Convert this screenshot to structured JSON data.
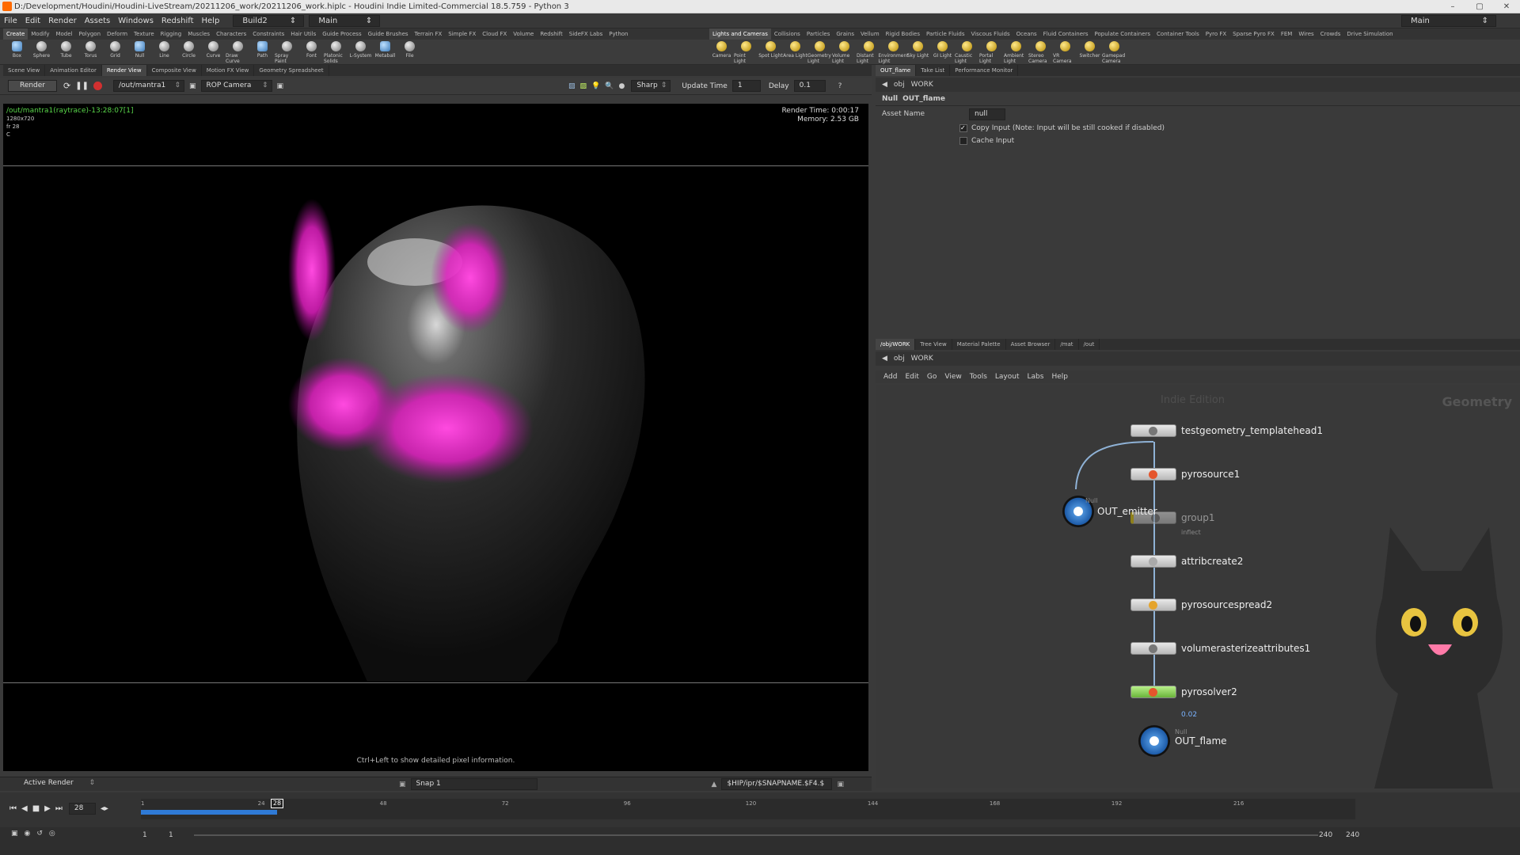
{
  "titlebar": {
    "title": "D:/Development/Houdini/Houdini-LiveStream/20211206_work/20211206_work.hiplc - Houdini Indie Limited-Commercial 18.5.759 - Python 3"
  },
  "menu": [
    "File",
    "Edit",
    "Render",
    "Assets",
    "Windows",
    "Redshift",
    "Help"
  ],
  "desktop": {
    "build": "Build2",
    "main": "Main",
    "right_main": "Main"
  },
  "shelf_tabs_left": [
    "Create",
    "Modify",
    "Model",
    "Polygon",
    "Deform",
    "Texture",
    "Rigging",
    "Muscles",
    "Characters",
    "Constraints",
    "Hair Utils",
    "Guide Process",
    "Guide Brushes",
    "Terrain FX",
    "Simple FX",
    "Cloud FX",
    "Volume",
    "Redshift",
    "SideFX Labs",
    "Python"
  ],
  "shelf_tabs_right": [
    "Lights and Cameras",
    "Collisions",
    "Particles",
    "Grains",
    "Vellum",
    "Rigid Bodies",
    "Particle Fluids",
    "Viscous Fluids",
    "Oceans",
    "Fluid Containers",
    "Populate Containers",
    "Container Tools",
    "Pyro FX",
    "Sparse Pyro FX",
    "FEM",
    "Wires",
    "Crowds",
    "Drive Simulation"
  ],
  "shelf_tools_left": [
    "Box",
    "Sphere",
    "Tube",
    "Torus",
    "Grid",
    "Null",
    "Line",
    "Circle",
    "Curve",
    "Draw Curve",
    "Path",
    "Spray Paint",
    "Font",
    "Platonic Solids",
    "L-System",
    "Metaball",
    "File"
  ],
  "shelf_tools_right": [
    "Camera",
    "Point Light",
    "Spot Light",
    "Area Light",
    "Geometry Light",
    "Volume Light",
    "Distant Light",
    "Environment Light",
    "Sky Light",
    "GI Light",
    "Caustic Light",
    "Portal Light",
    "Ambient Light",
    "Stereo Camera",
    "VR Camera",
    "Switcher",
    "Gamepad Camera"
  ],
  "viewer_tabs": [
    "Scene View",
    "Animation Editor",
    "Render View",
    "Composite View",
    "Motion FX View",
    "Geometry Spreadsheet"
  ],
  "viewer_active_tab": "Render View",
  "render_toolbar": {
    "render_label": "Render",
    "rop_path": "/out/mantra1",
    "camera": "ROP Camera",
    "sharp": "Sharp",
    "update_time_label": "Update Time",
    "update_time": "1",
    "delay_label": "Delay",
    "delay": "0.1"
  },
  "render_info": {
    "path": "/out/mantra1(raytrace)-13:28:07[1]",
    "res": "1280x720",
    "frame": "fr 28",
    "c": "C"
  },
  "render_stats": {
    "time_label": "Render Time:",
    "time": "0:00:17",
    "memory_label": "Memory:",
    "memory": "2.53 GB"
  },
  "hint": "Ctrl+Left to show detailed pixel information.",
  "viewer_status": {
    "active_render": "Active Render",
    "snap": "Snap 1",
    "path": "$HIP/ipr/$SNAPNAME.$F4.$"
  },
  "timeline": {
    "current_frame": "28",
    "ticks": [
      "1",
      "24",
      "48",
      "72",
      "96",
      "120",
      "144",
      "168",
      "192",
      "216"
    ],
    "start": "1",
    "start2": "1",
    "end": "240",
    "end2": "240"
  },
  "param_tabs": [
    "OUT_flame",
    "Take List",
    "Performance Monitor"
  ],
  "param_path": {
    "obj": "obj",
    "network": "WORK"
  },
  "param_node": {
    "type": "Null",
    "name": "OUT_flame",
    "asset_label": "Asset Name",
    "asset_value": "null",
    "copy_input": "Copy Input (Note: Input will be still cooked if disabled)",
    "cache_input": "Cache Input"
  },
  "net_tabs": [
    "/obj/WORK",
    "Tree View",
    "Material Palette",
    "Asset Browser",
    "/mat",
    "/out"
  ],
  "net_path": {
    "obj": "obj",
    "network": "WORK"
  },
  "net_menu": [
    "Add",
    "Edit",
    "Go",
    "View",
    "Tools",
    "Layout",
    "Labs",
    "Help"
  ],
  "net_watermark": {
    "edition": "Indie Edition",
    "context": "Geometry"
  },
  "nodes": [
    {
      "name": "testgeometry_templatehead1"
    },
    {
      "name": "pyrosource1"
    },
    {
      "name": "group1",
      "sub": "inflect"
    },
    {
      "name": "attribcreate2"
    },
    {
      "name": "pyrosourcespread2"
    },
    {
      "name": "volumerasterizeattributes1"
    },
    {
      "name": "pyrosolver2",
      "sub": "0.02"
    },
    {
      "name": "OUT_flame",
      "sub": "Null"
    },
    {
      "name": "OUT_emitter",
      "sub": "Null"
    }
  ],
  "colors": {
    "accent_green": "#59d64a",
    "flame": "#ff2bd6",
    "wire": "#8fb2d6"
  }
}
